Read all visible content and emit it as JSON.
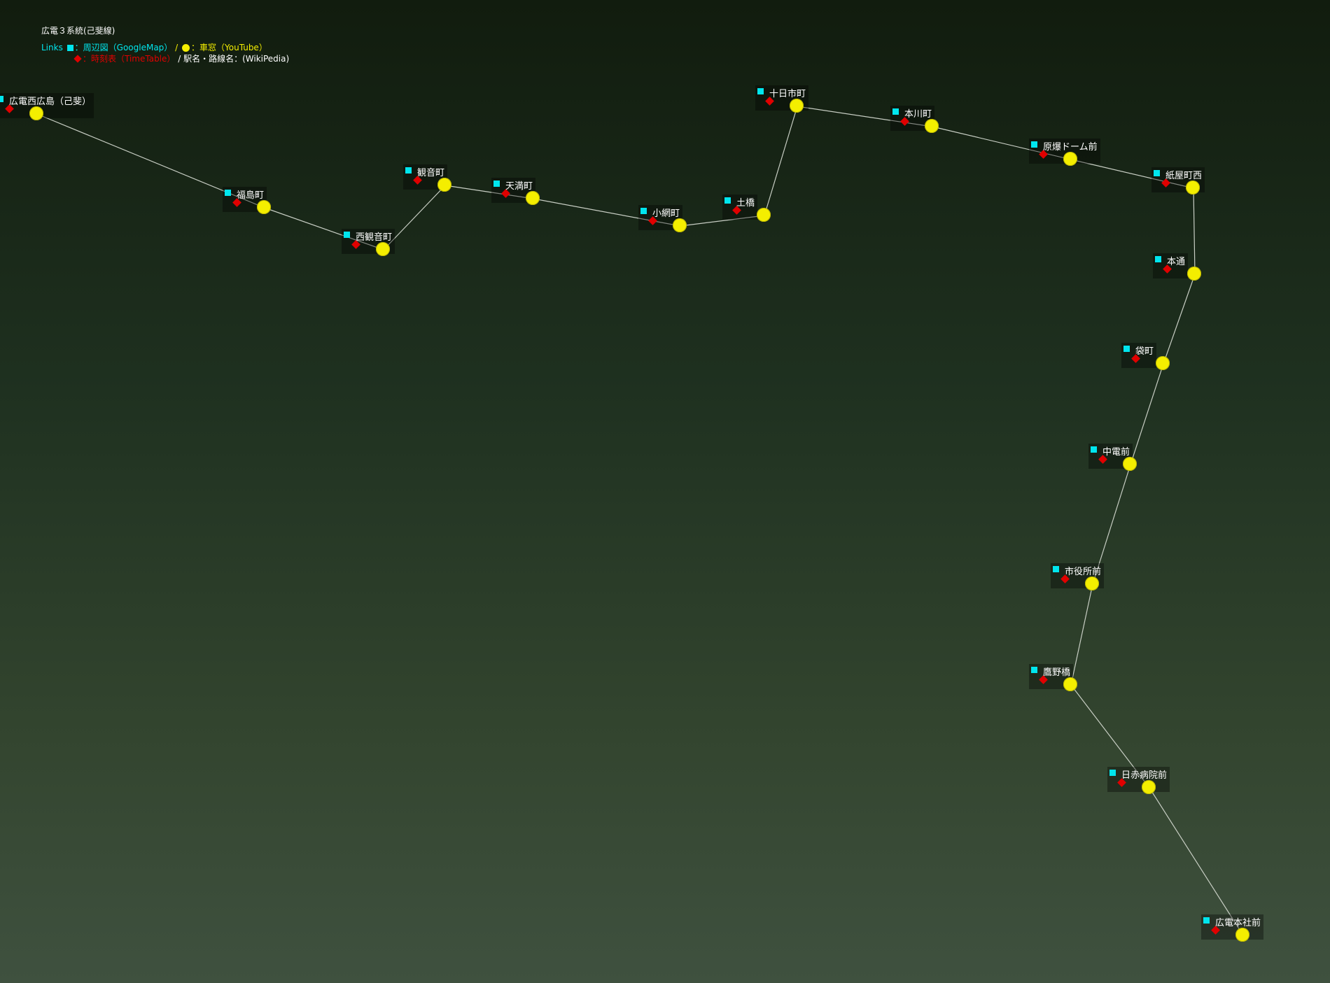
{
  "title": "広電３系統(己斐線)",
  "legend": {
    "links_label": "Links",
    "map_text": "：周辺図（GoogleMap）",
    "separator": "/",
    "video_text": "：車窓（YouTube）",
    "timetable_text": "：時刻表（TimeTable）",
    "wiki_text": "/ 駅名・路線名：(WikiPedia)",
    "map_icon": "cyan-square-icon",
    "video_icon": "yellow-circle-icon",
    "timetable_icon": "red-diamond-icon"
  },
  "colors": {
    "map_link": "#00e6ee",
    "video_link": "#f4ee00",
    "timetable_link": "#e00000",
    "route_line": "#c8cec4"
  },
  "stations": [
    {
      "name": "広電西広島（己斐）"
    },
    {
      "name": "福島町"
    },
    {
      "name": "西観音町"
    },
    {
      "name": "観音町"
    },
    {
      "name": "天満町"
    },
    {
      "name": "小網町"
    },
    {
      "name": "土橋"
    },
    {
      "name": "十日市町"
    },
    {
      "name": "本川町"
    },
    {
      "name": "原爆ドーム前"
    },
    {
      "name": "紙屋町西"
    },
    {
      "name": "本通"
    },
    {
      "name": "袋町"
    },
    {
      "name": "中電前"
    },
    {
      "name": "市役所前"
    },
    {
      "name": "鷹野橋"
    },
    {
      "name": "日赤病院前"
    },
    {
      "name": "広電本社前"
    }
  ]
}
